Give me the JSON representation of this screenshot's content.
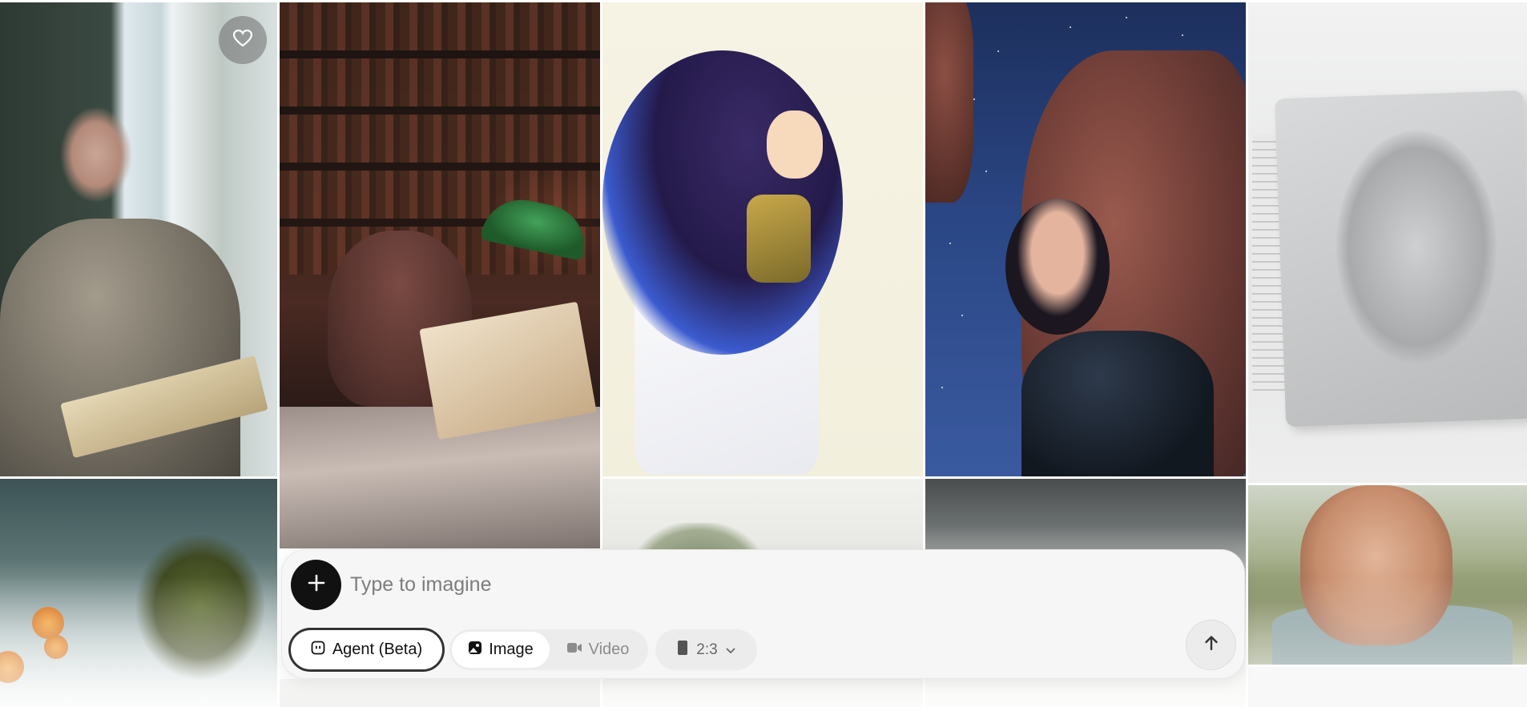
{
  "gallery": {
    "tiles": [
      {
        "name": "old-man-reading-by-window",
        "icon": "photo"
      },
      {
        "name": "octopus-reading-in-library",
        "icon": "photo"
      },
      {
        "name": "anime-girl-white-dress",
        "icon": "photo"
      },
      {
        "name": "woman-under-starry-sky",
        "icon": "photo"
      },
      {
        "name": "gray-sculpture-panel",
        "icon": "photo"
      },
      {
        "name": "plant-and-orange-flowers",
        "icon": "photo"
      },
      {
        "name": "misty-hills",
        "icon": "photo"
      },
      {
        "name": "smoky-landscape",
        "icon": "photo"
      },
      {
        "name": "old-man-portrait-field",
        "icon": "photo"
      }
    ],
    "favorite_icon": "heart-icon"
  },
  "prompt": {
    "placeholder": "Type to imagine",
    "value": "",
    "add_icon": "plus-icon",
    "send_icon": "arrow-up-icon",
    "agent": {
      "label": "Agent (Beta)",
      "icon": "agent-face-icon"
    },
    "modes": [
      {
        "label": "Image",
        "icon": "image-icon",
        "selected": true
      },
      {
        "label": "Video",
        "icon": "video-camera-icon",
        "selected": false
      }
    ],
    "aspect_ratio": {
      "label": "2:3",
      "icon": "portrait-rect-icon",
      "dropdown_icon": "chevron-down-icon"
    }
  },
  "colors": {
    "accent": "#111111",
    "panel_bg": "#f6f6f6",
    "chip_bg": "#ececec",
    "inactive_text": "#8c8c8c"
  }
}
